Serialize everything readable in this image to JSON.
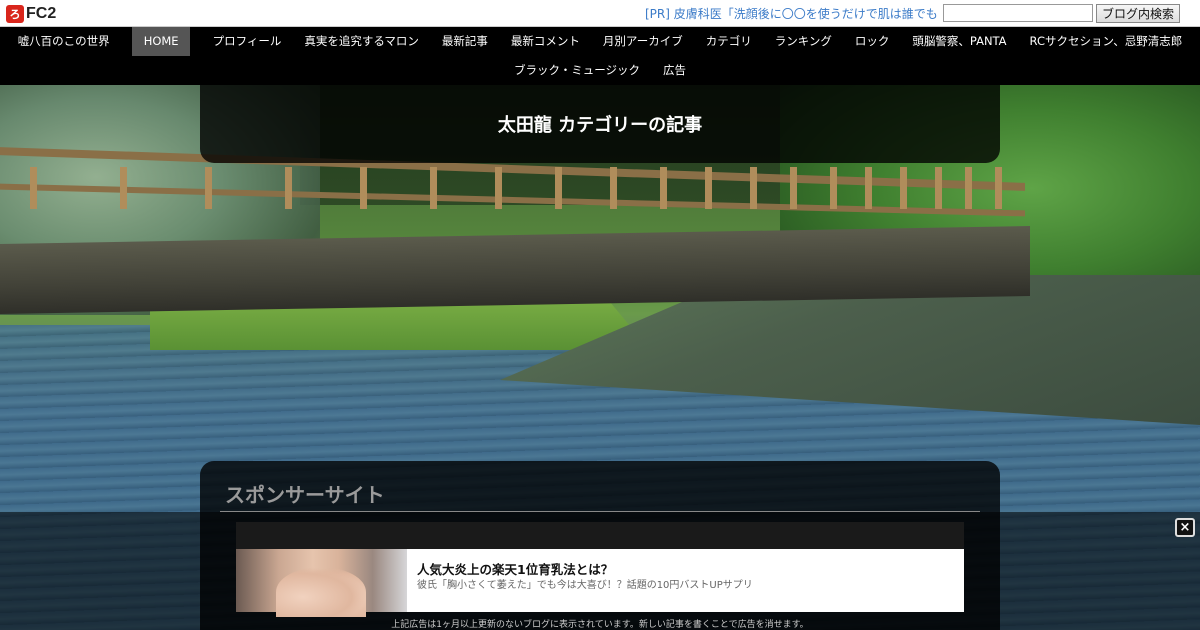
{
  "topbar": {
    "logo_text": "FC2",
    "logo_mark": "ろ",
    "pr_text": "[PR] 皮膚科医「洗顔後に〇〇を使うだけで肌は誰でも",
    "search_value": "",
    "search_button_label": "ブログ内検索"
  },
  "nav": {
    "row1": [
      "嘘八百のこの世界",
      "HOME",
      "プロフィール",
      "真実を追究するマロン",
      "最新記事",
      "最新コメント",
      "月別アーカイブ",
      "カテゴリ",
      "ランキング",
      "ロック",
      "頭脳警察、PANTA",
      "RCサクセション、忌野清志郎"
    ],
    "row2": [
      "ブラック・ミュージック",
      "広告"
    ],
    "active": "HOME"
  },
  "category_header": {
    "title": "太田龍 カテゴリーの記事"
  },
  "sponsor": {
    "title": "スポンサーサイト"
  },
  "ad": {
    "close_label": "×",
    "headline": "人気大炎上の楽天1位育乳法とは？",
    "description": "彼氏「胸小さくて萎えた」でも今は大喜び！？話題の10円バストUPサプリ",
    "notice": "上記広告は1ヶ月以上更新のないブログに表示されています。新しい記事を書くことで広告を消せます。"
  }
}
